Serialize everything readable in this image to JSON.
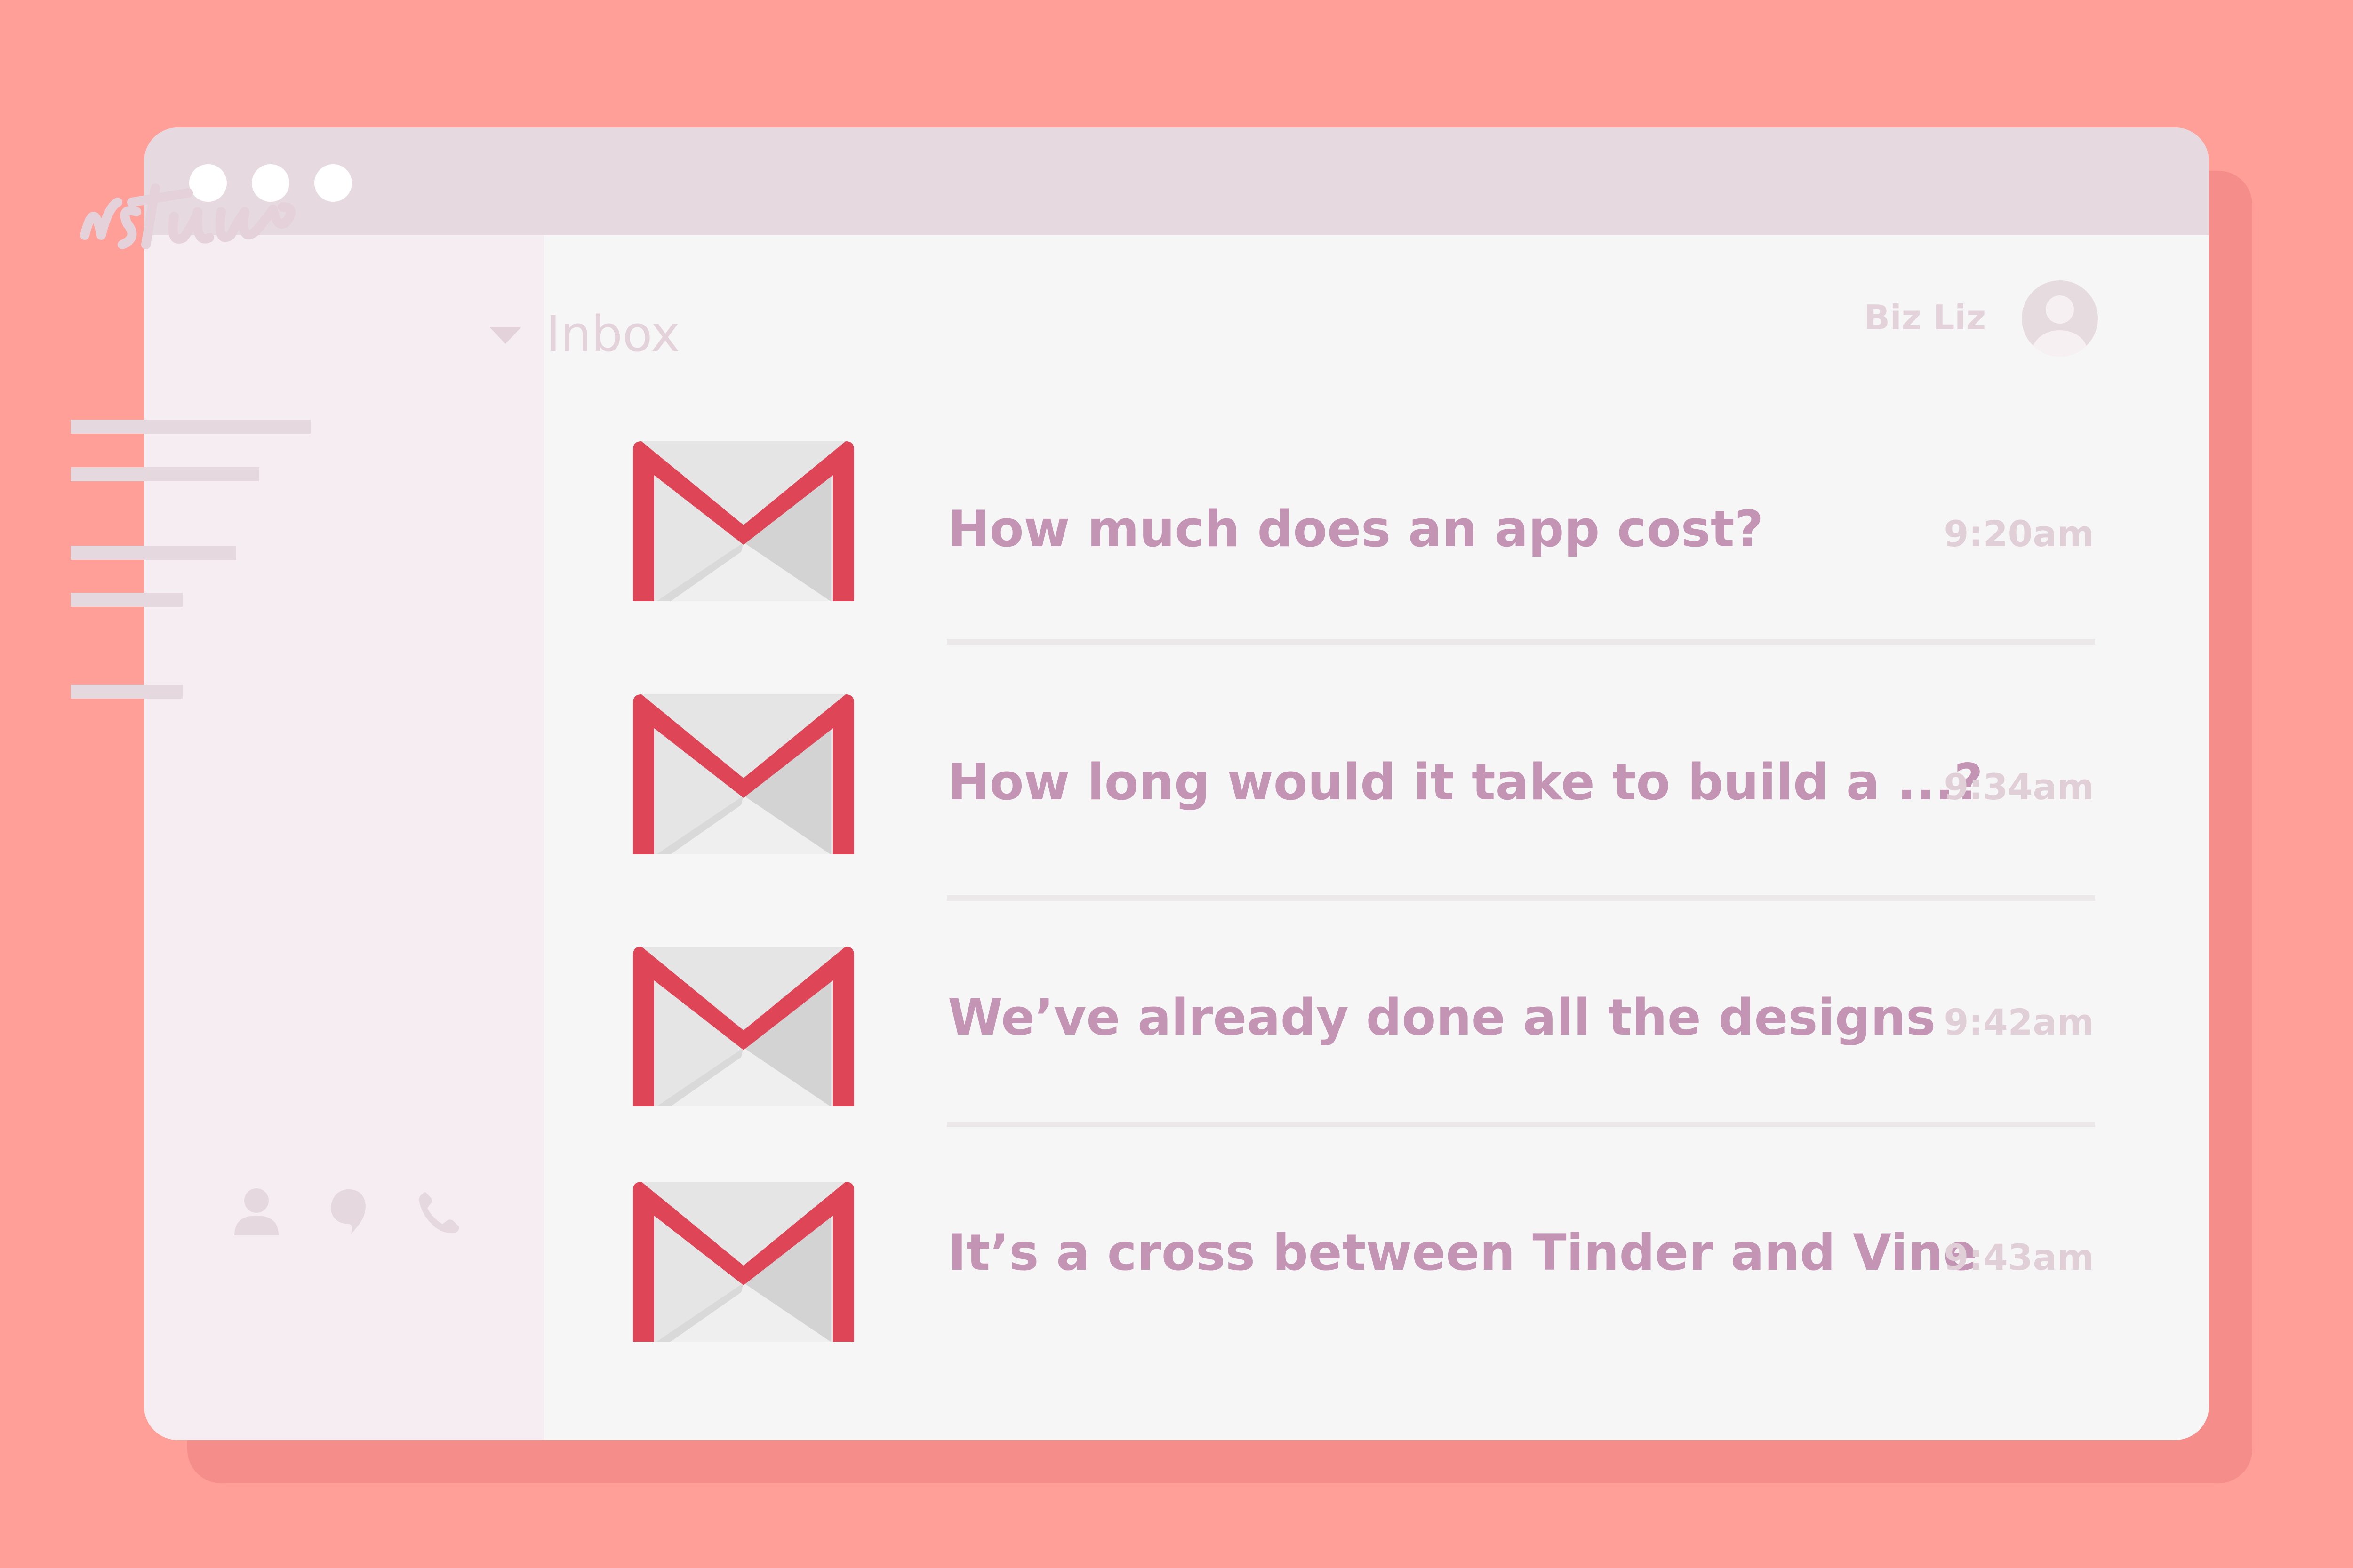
{
  "window": {
    "dots": [
      "window-dot",
      "window-dot",
      "window-dot"
    ]
  },
  "sidebar": {
    "logo_icon": "script-logo",
    "bottom_icons": [
      "person-icon",
      "chat-bubble-icon",
      "phone-icon"
    ]
  },
  "header": {
    "folder": "Inbox",
    "user_name": "Biz Liz"
  },
  "emails": [
    {
      "subject": "How much does an app cost?",
      "time": "9:20am"
    },
    {
      "subject": "How long would it take to build a ...?",
      "time": "9:34am"
    },
    {
      "subject": "We’ve already done all the designs",
      "time": "9:42am"
    },
    {
      "subject": "It’s a cross between Tinder and Vine",
      "time": "9:43am"
    }
  ],
  "colors": {
    "background": "#FF9F98",
    "titlebar": "#E6D9DF",
    "sidebar": "#F5EDF1",
    "content": "#F7F6F6",
    "subject_text": "#C394B4",
    "gmail_red": "#DE4658"
  }
}
